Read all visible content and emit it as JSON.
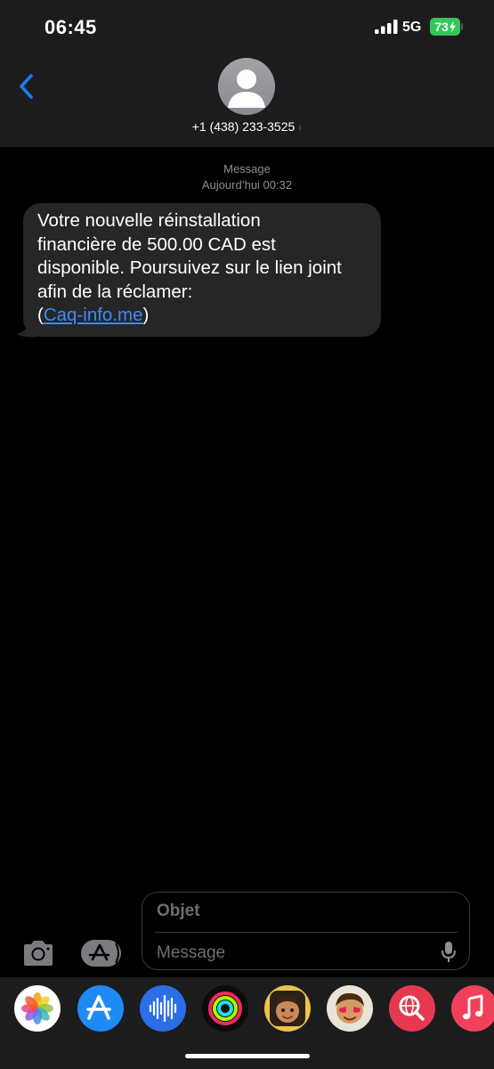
{
  "status_bar": {
    "time": "06:45",
    "network": "5G",
    "battery": "73"
  },
  "header": {
    "contact": "+1 (438) 233-3525",
    "chevron": "›"
  },
  "conversation": {
    "service_label": "Message",
    "timestamp": "Aujourd’hui 00:32",
    "message": {
      "line1": "Votre nouvelle réinstallation",
      "line2": "financière de 500.00 CAD est",
      "line3": "disponible. Poursuivez sur le lien joint",
      "line4": "afin de la réclamer:",
      "link_open": "(",
      "link_text": "Caq-info.me",
      "link_close": ")"
    }
  },
  "composer": {
    "subject_placeholder": "Objet",
    "message_placeholder": "Message"
  },
  "app_drawer": {
    "apps": [
      "photos-icon",
      "app-store-icon",
      "audio-message-icon",
      "activity-icon",
      "memoji-icon",
      "animoji-icon",
      "web-search-icon",
      "music-icon"
    ]
  },
  "colors": {
    "header_bg": "#1c1c1e",
    "bubble_bg": "#262628",
    "link": "#3e8bf5",
    "battery": "#34c759",
    "accent": "#1a7cf5"
  }
}
